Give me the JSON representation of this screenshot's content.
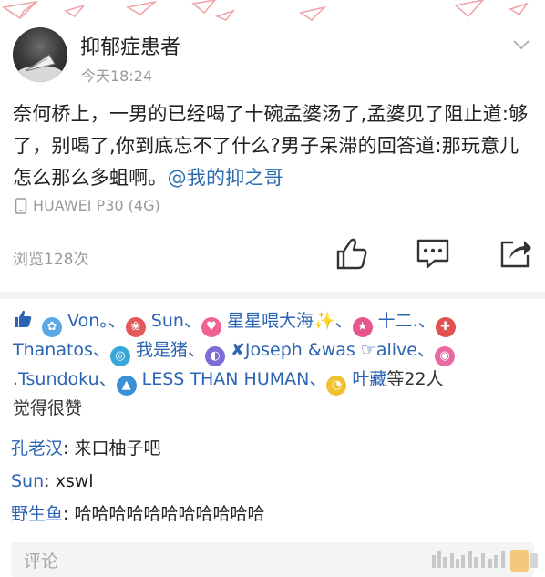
{
  "post": {
    "username": "抑郁症患者",
    "timestamp": "今天18:24",
    "content": "奈何桥上，一男的已经喝了十碗孟婆汤了,孟婆见了阻止道:够了，别喝了,你到底忘不了什么?男子呆滞的回答道:那玩意儿怎么那么多蛆啊。",
    "mention": "@我的抑之哥",
    "device": "HUAWEI P30 (4G)",
    "views": "浏览128次"
  },
  "likes": {
    "names": [
      {
        "name": "Von。",
        "icon": "gear-flower-icon",
        "color": "#5aa9e6"
      },
      {
        "name": "Sun",
        "icon": "flower-icon",
        "color": "#e25a5a"
      },
      {
        "name": "星星喂大海",
        "icon": "heart-icon",
        "color": "#f06292",
        "suffix": "✨"
      },
      {
        "name": "十二.",
        "icon": "star-icon",
        "color": "#e6558e"
      },
      {
        "name": "Thanatos",
        "icon": "shield-icon",
        "color": "#e2504f"
      },
      {
        "name": "我是猪",
        "icon": "ring-icon",
        "color": "#38a8d8"
      },
      {
        "name": "✘Joseph &was ☞alive",
        "icon": "eye-mask-icon",
        "color": "#7e6bd6"
      },
      {
        "name": ".Tsundoku",
        "icon": "lollipop-icon",
        "color": "#e86aa0"
      },
      {
        "name": "LESS THAN HUMAN",
        "icon": "rocket-icon",
        "color": "#3a8fd6"
      },
      {
        "name": "叶藏",
        "icon": "pacman-icon",
        "color": "#f2c12e"
      }
    ],
    "separator": "、",
    "suffix_count": "等22人",
    "suffix_text": "觉得很赞"
  },
  "comments": [
    {
      "name": "孔老汉",
      "text": ": 来口柚子吧"
    },
    {
      "name": "Sun",
      "text": ": xswl"
    },
    {
      "name": "野生鱼",
      "text": ": 哈哈哈哈哈哈哈哈哈哈哈"
    }
  ],
  "comment_input": {
    "placeholder": "评论"
  },
  "colors": {
    "link": "#2c64b4",
    "muted": "#9a9a9a",
    "text": "#222222"
  }
}
